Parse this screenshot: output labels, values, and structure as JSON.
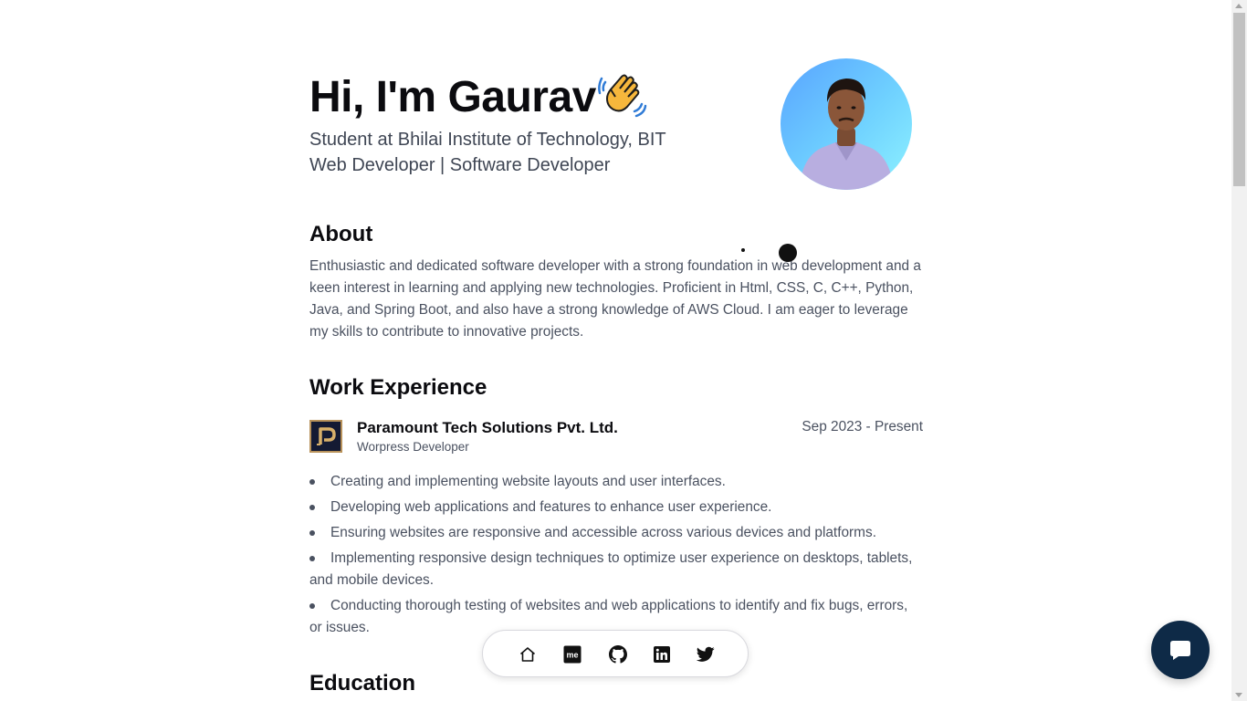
{
  "hero": {
    "greeting": "Hi, I'm Gaurav",
    "wave_icon": "waving-hand-icon",
    "subtitle_line1": "Student at Bhilai Institute of Technology, BIT",
    "subtitle_line2": "Web Developer | Software Developer"
  },
  "about": {
    "heading": "About",
    "text": "Enthusiastic and dedicated software developer with a strong foundation in web development and a keen interest in learning and applying new technologies. Proficient in Html, CSS, C, C++, Python, Java, and Spring Boot, and also have a strong knowledge of AWS Cloud. I am eager to leverage my skills to contribute to innovative projects."
  },
  "work": {
    "heading": "Work Experience",
    "items": [
      {
        "company": "Paramount Tech Solutions Pvt. Ltd.",
        "role": "Worpress Developer",
        "date": "Sep 2023 - Present",
        "logo_letter": "P",
        "bullets": [
          "Creating and implementing website layouts and user interfaces.",
          "Developing web applications and features to enhance user experience.",
          "Ensuring websites are responsive and accessible across various devices and platforms.",
          "Implementing responsive design techniques to optimize user experience on desktops, tablets, and mobile devices.",
          "Conducting thorough testing of websites and web applications to identify and fix bugs, errors, or issues."
        ]
      }
    ]
  },
  "education": {
    "heading": "Education"
  },
  "dock": {
    "items": [
      {
        "icon": "home-icon"
      },
      {
        "icon": "medium-icon",
        "text": "me"
      },
      {
        "icon": "github-icon"
      },
      {
        "icon": "linkedin-icon"
      },
      {
        "icon": "twitter-icon"
      }
    ]
  },
  "chat": {
    "icon": "chat-bubble-icon"
  },
  "colors": {
    "heading": "#0b0b0f",
    "body_text": "#4a5160",
    "subtitle": "#3f4654",
    "chat_button": "#0e2a47",
    "logo_border": "#b8925b",
    "logo_bg": "#141a33"
  }
}
